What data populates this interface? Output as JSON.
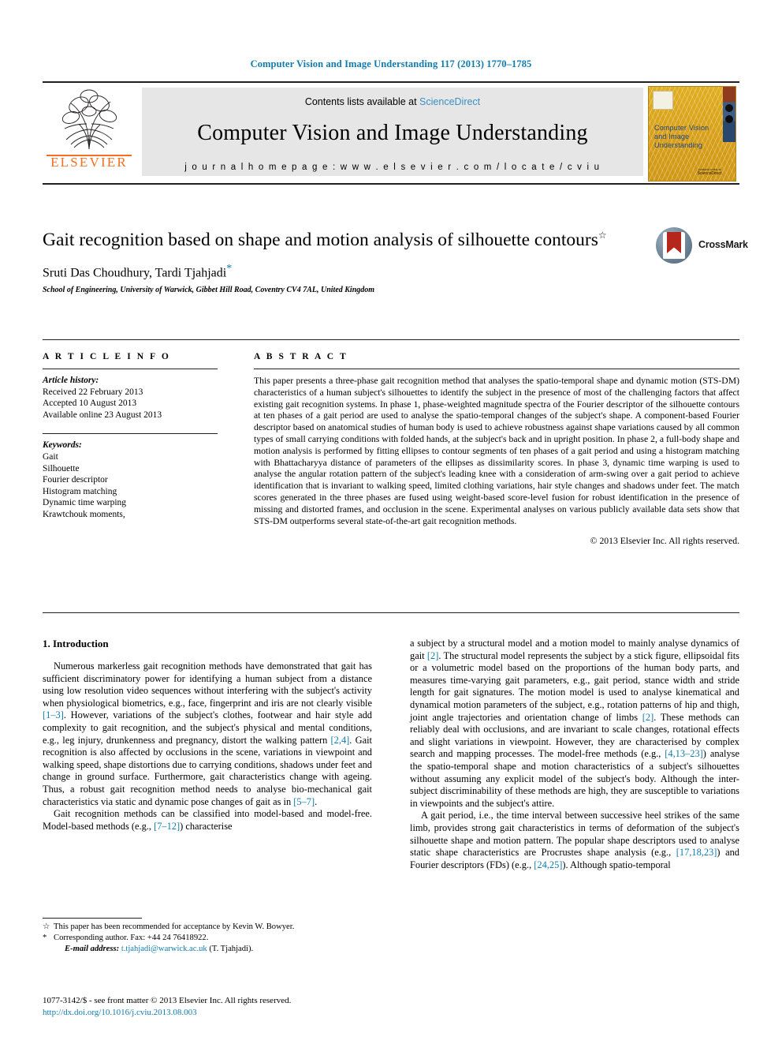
{
  "running_head": "Computer Vision and Image Understanding 117 (2013) 1770–1785",
  "masthead": {
    "contents_prefix": "Contents lists available at ",
    "sciencedirect": "ScienceDirect",
    "journal_title": "Computer Vision and Image Understanding",
    "homepage": "j o u r n a l   h o m e p a g e :   w w w . e l s e v i e r . c o m / l o c a t e / c v i u",
    "publisher_name": "ELSEVIER",
    "cover_title_line1": "Computer Vision",
    "cover_title_line2": "and Image",
    "cover_title_line3": "Understanding",
    "cover_footer_line1": "Available online at",
    "cover_footer_line2": "ScienceDirect"
  },
  "article": {
    "title": "Gait recognition based on shape and motion analysis of silhouette contours",
    "title_footnote_mark": "☆",
    "authors": "Sruti Das Choudhury, Tardi Tjahjadi",
    "corresponding_mark": "*",
    "affiliation": "School of Engineering, University of Warwick, Gibbet Hill Road, Coventry CV4 7AL, United Kingdom"
  },
  "crossmark": {
    "label": "CrossMark"
  },
  "article_info": {
    "heading": "A R T I C L E   I N F O",
    "history_label": "Article history:",
    "history": [
      "Received 22 February 2013",
      "Accepted 10 August 2013",
      "Available online 23 August 2013"
    ],
    "keywords_label": "Keywords:",
    "keywords": [
      "Gait",
      "Silhouette",
      "Fourier descriptor",
      "Histogram matching",
      "Dynamic time warping",
      "Krawtchouk moments,"
    ]
  },
  "abstract": {
    "heading": "A B S T R A C T",
    "text": "This paper presents a three-phase gait recognition method that analyses the spatio-temporal shape and dynamic motion (STS-DM) characteristics of a human subject's silhouettes to identify the subject in the presence of most of the challenging factors that affect existing gait recognition systems. In phase 1, phase-weighted magnitude spectra of the Fourier descriptor of the silhouette contours at ten phases of a gait period are used to analyse the spatio-temporal changes of the subject's shape. A component-based Fourier descriptor based on anatomical studies of human body is used to achieve robustness against shape variations caused by all common types of small carrying conditions with folded hands, at the subject's back and in upright position. In phase 2, a full-body shape and motion analysis is performed by fitting ellipses to contour segments of ten phases of a gait period and using a histogram matching with Bhattacharyya distance of parameters of the ellipses as dissimilarity scores. In phase 3, dynamic time warping is used to analyse the angular rotation pattern of the subject's leading knee with a consideration of arm-swing over a gait period to achieve identification that is invariant to walking speed, limited clothing variations, hair style changes and shadows under feet. The match scores generated in the three phases are fused using weight-based score-level fusion for robust identification in the presence of missing and distorted frames, and occlusion in the scene. Experimental analyses on various publicly available data sets show that STS-DM outperforms several state-of-the-art gait recognition methods.",
    "copyright": "© 2013 Elsevier Inc. All rights reserved."
  },
  "body": {
    "section_heading": "1. Introduction",
    "left_p1_a": "Numerous markerless gait recognition methods have demonstrated that gait has sufficient discriminatory power for identifying a human subject from a distance using low resolution video sequences without interfering with the subject's activity when physiological biometrics, e.g., face, fingerprint and iris are not clearly visible ",
    "left_p1_ref1": "[1–3]",
    "left_p1_b": ". However, variations of the subject's clothes, footwear and hair style add complexity to gait recognition, and the subject's physical and mental conditions, e.g., leg injury, drunkenness and pregnancy, distort the walking pattern ",
    "left_p1_ref2": "[2,4]",
    "left_p1_c": ". Gait recognition is also affected by occlusions in the scene, variations in viewpoint and walking speed, shape distortions due to carrying conditions, shadows under feet and change in ground surface. Furthermore, gait characteristics change with ageing. Thus, a robust gait recognition method needs to analyse bio-mechanical gait characteristics via static and dynamic pose changes of gait as in ",
    "left_p1_ref3": "[5–7]",
    "left_p1_d": ".",
    "left_p2_a": "Gait recognition methods can be classified into model-based and model-free. Model-based methods (e.g., ",
    "left_p2_ref1": "[7–12]",
    "left_p2_b": ") characterise",
    "right_p1_a": "a subject by a structural model and a motion model to mainly analyse dynamics of gait ",
    "right_p1_ref1": "[2]",
    "right_p1_b": ". The structural model represents the subject by a stick figure, ellipsoidal fits or a volumetric model based on the proportions of the human body parts, and measures time-varying gait parameters, e.g., gait period, stance width and stride length for gait signatures. The motion model is used to analyse kinematical and dynamical motion parameters of the subject, e.g., rotation patterns of hip and thigh, joint angle trajectories and orientation change of limbs ",
    "right_p1_ref2": "[2]",
    "right_p1_c": ". These methods can reliably deal with occlusions, and are invariant to scale changes, rotational effects and slight variations in viewpoint. However, they are characterised by complex search and mapping processes. The model-free methods (e.g., ",
    "right_p1_ref3": "[4,13–23]",
    "right_p1_d": ") analyse the spatio-temporal shape and motion characteristics of a subject's silhouettes without assuming any explicit model of the subject's body. Although the inter-subject discriminability of these methods are high, they are susceptible to variations in viewpoints and the subject's attire.",
    "right_p2_a": "A gait period, i.e., the time interval between successive heel strikes of the same limb, provides strong gait characteristics in terms of deformation of the subject's silhouette shape and motion pattern. The popular shape descriptors used to analyse static shape characteristics are Procrustes shape analysis (e.g., ",
    "right_p2_ref1": "[17,18,23]",
    "right_p2_b": ") and Fourier descriptors (FDs) (e.g., ",
    "right_p2_ref2": "[24,25]",
    "right_p2_c": "). Although spatio-temporal"
  },
  "footnotes": {
    "fn1_mark": "☆",
    "fn1_text": "This paper has been recommended for acceptance by Kevin W. Bowyer.",
    "fn2_mark": "*",
    "fn2_text": "Corresponding author. Fax: +44 24 76418922.",
    "email_label": "E-mail address:",
    "email": "t.tjahjadi@warwick.ac.uk",
    "email_suffix": "(T. Tjahjadi).",
    "issn_line": "1077-3142/$ - see front matter © 2013 Elsevier Inc. All rights reserved.",
    "doi": "http://dx.doi.org/10.1016/j.cviu.2013.08.003"
  },
  "colors": {
    "link": "#0f7cb0",
    "elsevier_orange": "#f36f21",
    "masthead_bg": "#e6e6e6",
    "cover_yellow": "#d8a31a"
  }
}
